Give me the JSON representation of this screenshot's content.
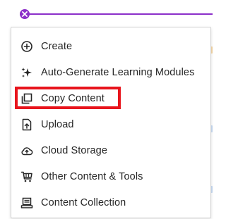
{
  "add_button": {
    "icon": "close-x-icon",
    "accent_color": "#8b2fc9"
  },
  "menu": {
    "items": [
      {
        "label": "Create",
        "icon": "plus-circle-icon"
      },
      {
        "label": "Auto-Generate Learning Modules",
        "icon": "sparkle-icon"
      },
      {
        "label": "Copy Content",
        "icon": "copy-icon",
        "highlighted": true,
        "highlight_color": "#e8141c"
      },
      {
        "label": "Upload",
        "icon": "upload-file-icon"
      },
      {
        "label": "Cloud Storage",
        "icon": "cloud-upload-icon"
      },
      {
        "label": "Other Content & Tools",
        "icon": "cart-tools-icon"
      },
      {
        "label": "Content Collection",
        "icon": "content-collection-icon"
      }
    ]
  }
}
